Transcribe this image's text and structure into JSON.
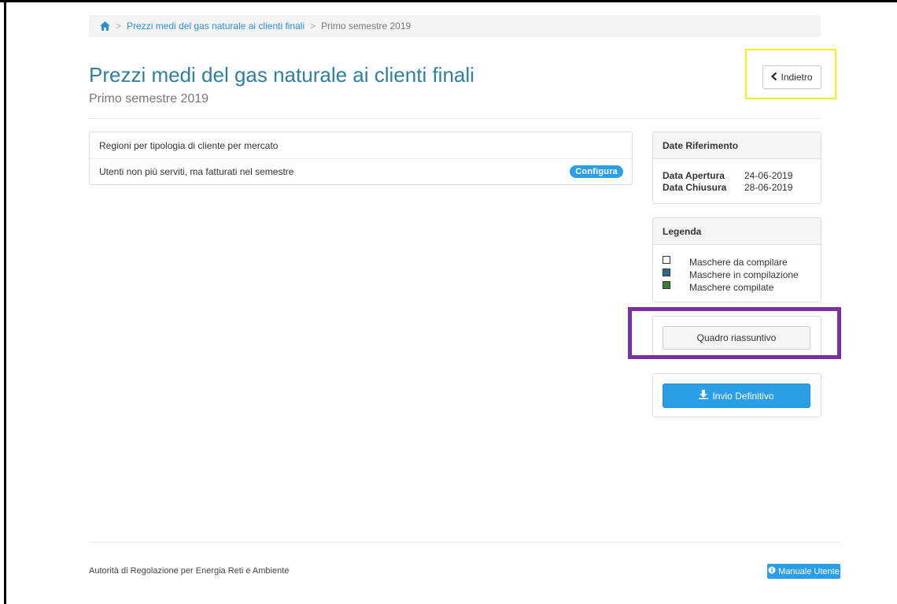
{
  "breadcrumb": {
    "home_icon": "home-icon",
    "separator": ">",
    "link": "Prezzi medi del gas naturale ai clienti finali",
    "current": "Primo semestre 2019"
  },
  "header": {
    "title": "Prezzi medi del gas naturale ai clienti finali",
    "subtitle": "Primo semestre 2019",
    "back_label": "Indietro",
    "back_icon": "chevron-left-icon"
  },
  "list": {
    "rows": [
      {
        "label": "Regioni per tipologia di cliente per mercato"
      },
      {
        "label": "Utenti non più serviti, ma fatturati nel semestre",
        "badge": "Configura"
      }
    ]
  },
  "dates": {
    "title": "Date Riferimento",
    "opening_label": "Data Apertura",
    "opening_value": "24-06-2019",
    "closing_label": "Data Chiusura",
    "closing_value": "28-06-2019"
  },
  "legend": {
    "title": "Legenda",
    "items": [
      {
        "label": "Maschere da compilare",
        "color": "#ffffff"
      },
      {
        "label": "Maschere in compilazione",
        "color": "#2e6c8c"
      },
      {
        "label": "Maschere compilate",
        "color": "#3a7d3a"
      }
    ]
  },
  "summary": {
    "label": "Quadro riassuntivo"
  },
  "send": {
    "label": "Invio Definitivo",
    "icon": "download-icon"
  },
  "footer": {
    "text": "Autorità di Regolazione per Energia Reti e Ambiente",
    "manual_label": "Manuale Utente",
    "manual_icon": "info-circle-icon"
  },
  "colors": {
    "accent": "#2a9ee6",
    "title": "#2f7fa3",
    "highlight_yellow": "#f4f11a",
    "highlight_purple": "#7a2fa6"
  }
}
